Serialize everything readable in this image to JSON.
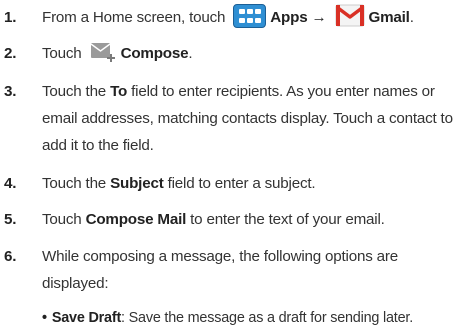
{
  "steps": [
    {
      "number": "1.",
      "a": "From a Home screen, touch",
      "apps_label": "Apps",
      "arrow": "→",
      "gmail_label": "Gmail",
      "end": ".",
      "icons": [
        "apps-grid-icon",
        "gmail-envelope-icon"
      ]
    },
    {
      "number": "2.",
      "a": "Touch",
      "compose_label": "Compose",
      "end": ".",
      "icons": [
        "compose-envelope-icon"
      ]
    },
    {
      "number": "3.",
      "a": "Touch the",
      "to_label": "To",
      "b": "field to enter recipients. As you enter names or email addresses, matching contacts display. Touch a contact to add it to the field."
    },
    {
      "number": "4.",
      "a": "Touch the",
      "subject_label": "Subject",
      "b": "field to enter a subject."
    },
    {
      "number": "5.",
      "a": "Touch",
      "compose_mail_label": "Compose Mail",
      "b": "to enter the text of your email."
    },
    {
      "number": "6.",
      "text": "While composing a message, the following options are displayed:"
    }
  ],
  "bullets": [
    {
      "dot": "•",
      "label": "Save Draft",
      "text": ": Save the message as a draft for sending later."
    }
  ],
  "colors": {
    "text": "#333333",
    "apps_icon_blue": "#2f8fd3",
    "gmail_red": "#d93025"
  }
}
